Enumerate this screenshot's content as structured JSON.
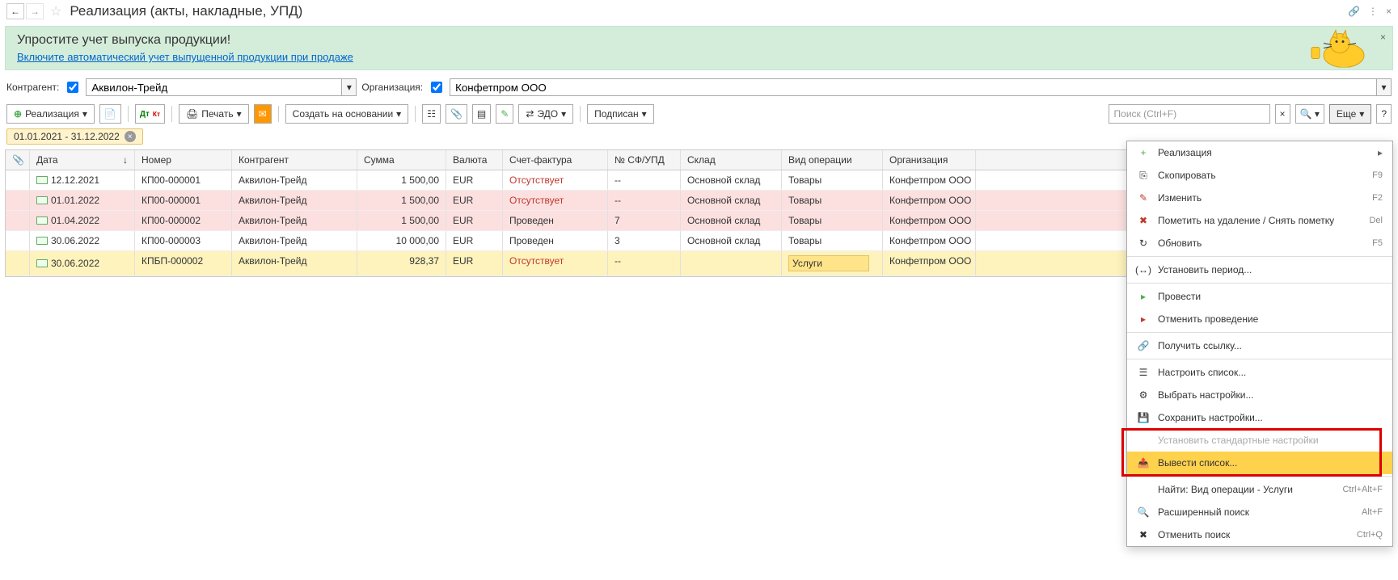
{
  "title": "Реализация (акты, накладные, УПД)",
  "promo": {
    "title": "Упростите учет выпуска продукции!",
    "link": "Включите автоматический учет выпущенной продукции при продаже"
  },
  "filters": {
    "counterparty_label": "Контрагент:",
    "counterparty_value": "Аквилон-Трейд",
    "org_label": "Организация:",
    "org_value": "Конфетпром ООО"
  },
  "toolbar": {
    "main_btn": "Реализация",
    "print": "Печать",
    "create_based": "Создать на основании",
    "edo": "ЭДО",
    "signed": "Подписан",
    "search_placeholder": "Поиск (Ctrl+F)",
    "more": "Еще"
  },
  "chip": {
    "range": "01.01.2021 - 31.12.2022"
  },
  "columns": {
    "date": "Дата",
    "num": "Номер",
    "ctr": "Контрагент",
    "sum": "Сумма",
    "cur": "Валюта",
    "sf": "Счет-фактура",
    "sfn": "№ СФ/УПД",
    "wh": "Склад",
    "op": "Вид операции",
    "org": "Организация"
  },
  "rows": [
    {
      "date": "12.12.2021",
      "num": "КП00-000001",
      "ctr": "Аквилон-Трейд",
      "sum": "1 500,00",
      "cur": "EUR",
      "sf": "Отсутствует",
      "sf_red": true,
      "sfn": "--",
      "wh": "Основной склад",
      "op": "Товары",
      "org": "Конфетпром ООО",
      "pink": false
    },
    {
      "date": "01.01.2022",
      "num": "КП00-000001",
      "ctr": "Аквилон-Трейд",
      "sum": "1 500,00",
      "cur": "EUR",
      "sf": "Отсутствует",
      "sf_red": true,
      "sfn": "--",
      "wh": "Основной склад",
      "op": "Товары",
      "org": "Конфетпром ООО",
      "pink": true
    },
    {
      "date": "01.04.2022",
      "num": "КП00-000002",
      "ctr": "Аквилон-Трейд",
      "sum": "1 500,00",
      "cur": "EUR",
      "sf": "Проведен",
      "sf_red": false,
      "sfn": "7",
      "wh": "Основной склад",
      "op": "Товары",
      "org": "Конфетпром ООО",
      "pink": true
    },
    {
      "date": "30.06.2022",
      "num": "КП00-000003",
      "ctr": "Аквилон-Трейд",
      "sum": "10 000,00",
      "cur": "EUR",
      "sf": "Проведен",
      "sf_red": false,
      "sfn": "3",
      "wh": "Основной склад",
      "op": "Товары",
      "org": "Конфетпром ООО",
      "pink": false
    },
    {
      "date": "30.06.2022",
      "num": "КПБП-000002",
      "ctr": "Аквилон-Трейд",
      "sum": "928,37",
      "cur": "EUR",
      "sf": "Отсутствует",
      "sf_red": true,
      "sfn": "--",
      "wh": "",
      "op": "Услуги",
      "org": "Конфетпром ООО",
      "pink": false,
      "selected": true,
      "op_hl": true
    }
  ],
  "menu": [
    {
      "label": "Реализация",
      "icon": "+",
      "icon_color": "#4caf50",
      "sub": true
    },
    {
      "label": "Скопировать",
      "icon": "⎘",
      "shortcut": "F9"
    },
    {
      "label": "Изменить",
      "icon": "✎",
      "icon_color": "#c0392b",
      "shortcut": "F2"
    },
    {
      "label": "Пометить на удаление / Снять пометку",
      "icon": "✖",
      "icon_color": "#c0392b",
      "shortcut": "Del"
    },
    {
      "label": "Обновить",
      "icon": "↻",
      "shortcut": "F5"
    },
    {
      "sep": true
    },
    {
      "label": "Установить период...",
      "icon": "(↔)"
    },
    {
      "sep": true
    },
    {
      "label": "Провести",
      "icon": "▸",
      "icon_color": "#4caf50"
    },
    {
      "label": "Отменить проведение",
      "icon": "▸",
      "icon_color": "#c0392b"
    },
    {
      "sep": true
    },
    {
      "label": "Получить ссылку...",
      "icon": "🔗"
    },
    {
      "sep": true
    },
    {
      "label": "Настроить список...",
      "icon": "☰"
    },
    {
      "label": "Выбрать настройки...",
      "icon": "⚙"
    },
    {
      "label": "Сохранить настройки...",
      "icon": "💾"
    },
    {
      "label": "Установить стандартные настройки",
      "disabled": true
    },
    {
      "label": "Вывести список...",
      "icon": "📤",
      "highlight": true
    },
    {
      "sep": true
    },
    {
      "label": "Найти: Вид операции - Услуги",
      "shortcut": "Ctrl+Alt+F"
    },
    {
      "label": "Расширенный поиск",
      "icon": "🔍",
      "shortcut": "Alt+F"
    },
    {
      "label": "Отменить поиск",
      "icon": "✖",
      "shortcut": "Ctrl+Q"
    }
  ]
}
